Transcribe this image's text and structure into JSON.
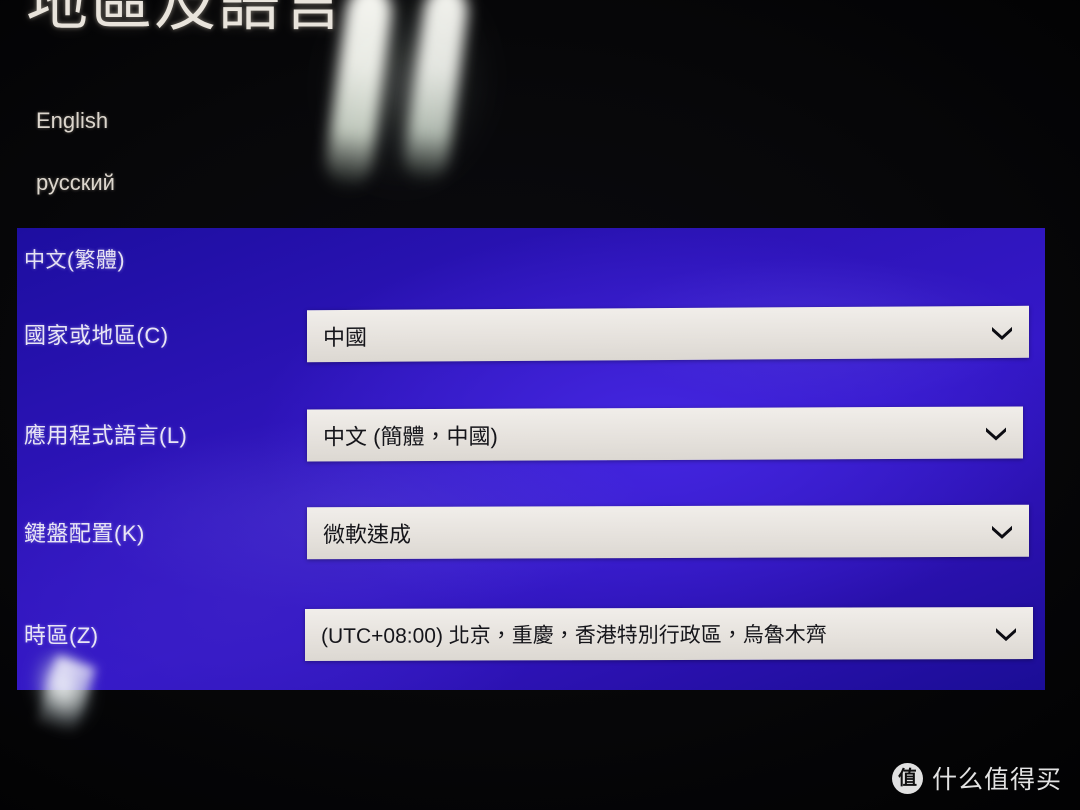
{
  "page": {
    "title": "地區及語言",
    "watermark_logo_glyph": "值",
    "watermark_text": "什么值得买"
  },
  "language_list": {
    "items": [
      {
        "label": "English"
      },
      {
        "label": "русский"
      }
    ]
  },
  "settings_panel": {
    "heading": "中文(繁體)",
    "accent_color": "#2d14b8",
    "rows": [
      {
        "label": "國家或地區(C)",
        "value": "中國",
        "arrow_icon": "chevron-down-icon"
      },
      {
        "label": "應用程式語言(L)",
        "value": "中文 (簡體，中國)",
        "arrow_icon": "chevron-down-icon"
      },
      {
        "label": "鍵盤配置(K)",
        "value": "微軟速成",
        "arrow_icon": "chevron-down-icon"
      },
      {
        "label": "時區(Z)",
        "value": "(UTC+08:00) 北京，重慶，香港特別行政區，烏魯木齊",
        "arrow_icon": "chevron-down-icon"
      }
    ]
  }
}
